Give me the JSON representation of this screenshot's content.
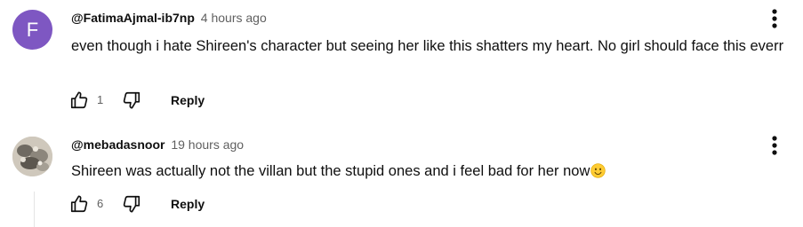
{
  "comments": [
    {
      "avatar_letter": "F",
      "avatar_color": "#7e57c2",
      "author": "@FatimaAjmal-ib7np",
      "time": "4 hours ago",
      "text": "even though i hate Shireen's character but seeing her like this shatters my heart. No girl should face this everr",
      "like_count": "1",
      "reply_label": "Reply",
      "icons": {
        "like": "thumb-up-icon",
        "dislike": "thumb-down-icon",
        "more": "more-vert-icon"
      }
    },
    {
      "avatar_letter": "",
      "author": "@mebadasnoor",
      "time": "19 hours ago",
      "text": "Shireen was actually not the villan but the stupid ones and i feel bad for her now",
      "emoji": "slightly-smiling-face-emoji",
      "like_count": "6",
      "reply_label": "Reply",
      "icons": {
        "like": "thumb-up-icon",
        "dislike": "thumb-down-icon",
        "more": "more-vert-icon"
      }
    }
  ],
  "colors": {
    "text_primary": "#0f0f0f",
    "text_secondary": "#606060"
  }
}
